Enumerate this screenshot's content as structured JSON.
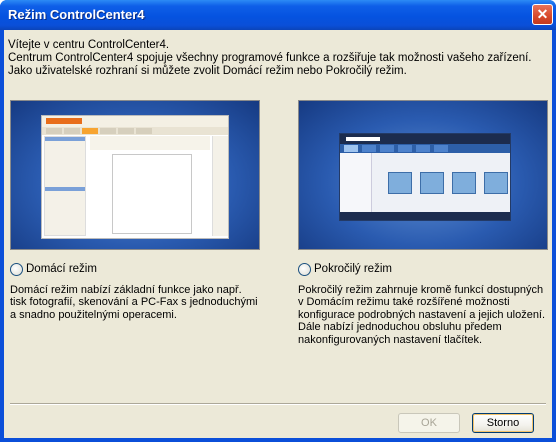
{
  "window": {
    "title": "Režim ControlCenter4",
    "close_glyph": "✕"
  },
  "intro": {
    "line1": "Vítejte v centru ControlCenter4.",
    "line2": "Centrum ControlCenter4 spojuje všechny programové funkce a rozšiřuje tak možnosti vašeho zařízení.",
    "line3": "Jako uživatelské rozhraní si můžete zvolit Domácí režim nebo Pokročilý režim."
  },
  "home_mode": {
    "label": "Domácí režim",
    "selected": false,
    "description": "Domácí režim nabízí základní funkce jako např. tisk fotografií, skenování a PC-Fax s jednoduchými a snadno použitelnými operacemi."
  },
  "advanced_mode": {
    "label": "Pokročilý režim",
    "selected": false,
    "description": "Pokročilý režim zahrnuje kromě funkcí dostupných v Domácím režimu také rozšířené možnosti konfigurace podrobných nastavení a jejich uložení. Dále nabízí jednoduchou obsluhu předem nakonfigurovaných nastavení tlačítek."
  },
  "buttons": {
    "ok_label": "OK",
    "ok_enabled": false,
    "cancel_label": "Storno"
  },
  "colors": {
    "titlebar": "#0553e0",
    "client_bg": "#ece9d8",
    "preview_bg": "#2a5bb0",
    "close_button": "#d8482a"
  }
}
